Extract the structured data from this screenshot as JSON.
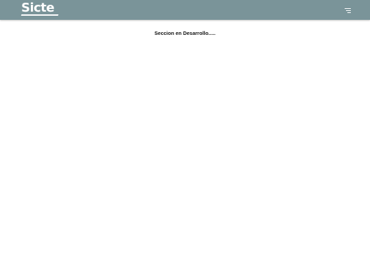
{
  "header": {
    "logo_text": "Sicte",
    "menu_icon": "hamburger-menu-icon",
    "background_color": "#7a9499"
  },
  "main": {
    "status_message": "Seccion en Desarrollo....."
  }
}
